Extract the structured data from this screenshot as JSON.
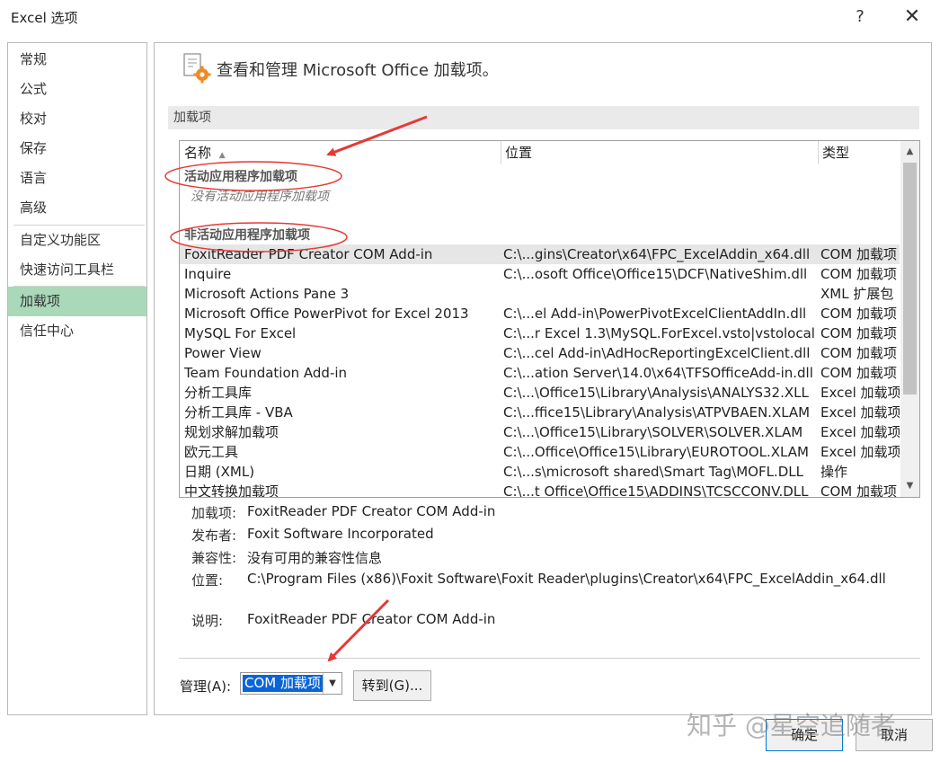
{
  "window": {
    "title": "Excel 选项",
    "help": "?",
    "close": "✕"
  },
  "nav": {
    "items": [
      {
        "label": "常规"
      },
      {
        "label": "公式"
      },
      {
        "label": "校对"
      },
      {
        "label": "保存"
      },
      {
        "label": "语言"
      },
      {
        "label": "高级"
      },
      {
        "label": "自定义功能区"
      },
      {
        "label": "快速访问工具栏"
      },
      {
        "label": "加载项"
      },
      {
        "label": "信任中心"
      }
    ]
  },
  "main": {
    "header": "查看和管理 Microsoft Office 加载项。",
    "section": "加载项",
    "columns": {
      "name": "名称",
      "location": "位置",
      "type": "类型",
      "sort_indicator": "▲"
    },
    "active_group": "活动应用程序加载项",
    "active_empty": "没有活动应用程序加载项",
    "inactive_group": "非活动应用程序加载项",
    "rows": [
      {
        "name": "FoxitReader PDF Creator COM Add-in",
        "location": "C:\\...gins\\Creator\\x64\\FPC_ExcelAddin_x64.dll",
        "type": "COM 加载项"
      },
      {
        "name": "Inquire",
        "location": "C:\\...osoft Office\\Office15\\DCF\\NativeShim.dll",
        "type": "COM 加载项"
      },
      {
        "name": "Microsoft Actions Pane 3",
        "location": "",
        "type": "XML 扩展包"
      },
      {
        "name": "Microsoft Office PowerPivot for Excel 2013",
        "location": "C:\\...el Add-in\\PowerPivotExcelClientAddIn.dll",
        "type": "COM 加载项"
      },
      {
        "name": "MySQL For Excel",
        "location": "C:\\...r Excel 1.3\\MySQL.ForExcel.vsto|vstolocal",
        "type": "COM 加载项"
      },
      {
        "name": "Power View",
        "location": "C:\\...cel Add-in\\AdHocReportingExcelClient.dll",
        "type": "COM 加载项"
      },
      {
        "name": "Team Foundation Add-in",
        "location": "C:\\...ation Server\\14.0\\x64\\TFSOfficeAdd-in.dll",
        "type": "COM 加载项"
      },
      {
        "name": "分析工具库",
        "location": "C:\\...\\Office15\\Library\\Analysis\\ANALYS32.XLL",
        "type": "Excel 加载项"
      },
      {
        "name": "分析工具库 - VBA",
        "location": "C:\\...ffice15\\Library\\Analysis\\ATPVBAEN.XLAM",
        "type": "Excel 加载项"
      },
      {
        "name": "规划求解加载项",
        "location": "C:\\...\\Office15\\Library\\SOLVER\\SOLVER.XLAM",
        "type": "Excel 加载项"
      },
      {
        "name": "欧元工具",
        "location": "C:\\...Office\\Office15\\Library\\EUROTOOL.XLAM",
        "type": "Excel 加载项"
      },
      {
        "name": "日期 (XML)",
        "location": "C:\\...s\\microsoft shared\\Smart Tag\\MOFL.DLL",
        "type": "操作"
      },
      {
        "name": "中文转换加载项",
        "location": "C:\\...t Office\\Office15\\ADDINS\\TCSCCONV.DLL",
        "type": "COM 加载项"
      }
    ],
    "details": {
      "addin_label": "加载项:",
      "addin": "FoxitReader PDF Creator COM Add-in",
      "publisher_label": "发布者:",
      "publisher": "Foxit Software Incorporated",
      "compat_label": "兼容性:",
      "compat": "没有可用的兼容性信息",
      "location_label": "位置:",
      "location": "C:\\Program Files (x86)\\Foxit Software\\Foxit Reader\\plugins\\Creator\\x64\\FPC_ExcelAddin_x64.dll",
      "desc_label": "说明:",
      "desc": "FoxitReader PDF Creator COM Add-in"
    },
    "manage": {
      "label": "管理(A):",
      "value": "COM 加载项",
      "goto": "转到(G)..."
    }
  },
  "footer": {
    "ok": "确定",
    "cancel": "取消"
  },
  "watermark": "知乎 @星空追随者",
  "colors": {
    "nav_active": "#a9d9b8",
    "selection": "#0a64d8",
    "annotation": "#e53935"
  }
}
